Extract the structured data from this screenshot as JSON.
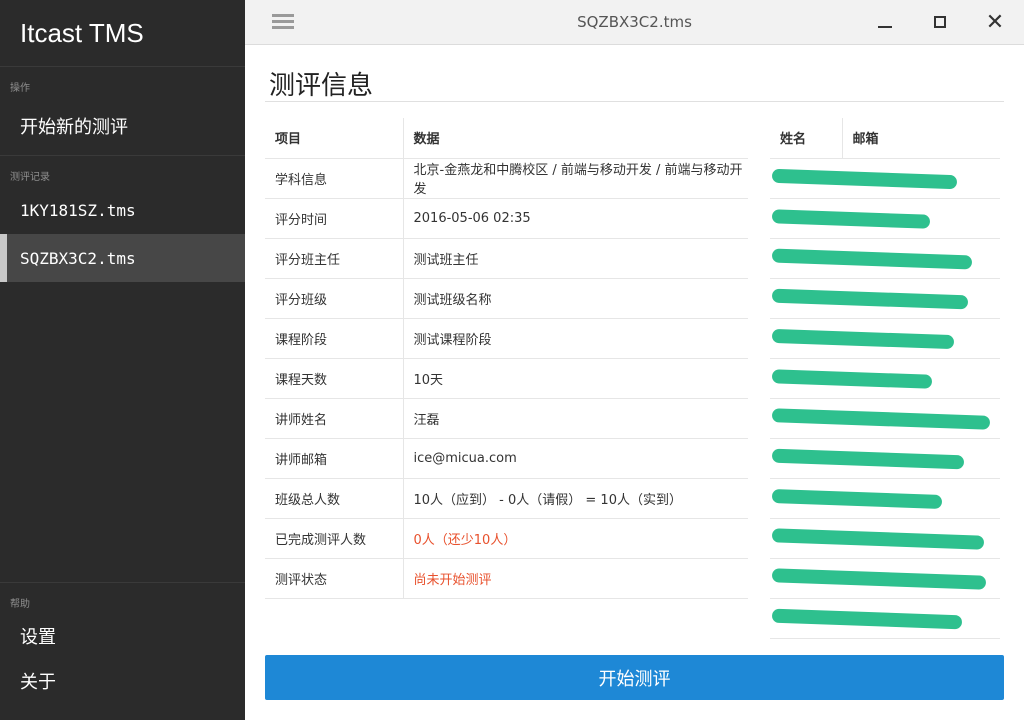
{
  "app": {
    "title": "Itcast TMS"
  },
  "sidebar": {
    "section_ops": "操作",
    "new_eval": "开始新的测评",
    "section_records": "测评记录",
    "records": [
      "1KY181SZ.tms",
      "SQZBX3C2.tms"
    ],
    "section_help": "帮助",
    "settings": "设置",
    "about": "关于"
  },
  "window": {
    "title": "SQZBX3C2.tms",
    "close_glyph": "✕"
  },
  "main": {
    "title": "测评信息",
    "info_headers": [
      "项目",
      "数据"
    ],
    "info_rows": [
      [
        "学科信息",
        "北京-金燕龙和中腾校区 / 前端与移动开发 / 前端与移动开发"
      ],
      [
        "评分时间",
        "2016-05-06 02:35"
      ],
      [
        "评分班主任",
        "测试班主任"
      ],
      [
        "评分班级",
        "测试班级名称"
      ],
      [
        "课程阶段",
        "测试课程阶段"
      ],
      [
        "课程天数",
        "10天"
      ],
      [
        "讲师姓名",
        "汪磊"
      ],
      [
        "讲师邮箱",
        "ice@micua.com"
      ],
      [
        "班级总人数",
        "10人（应到） - 0人（请假） = 10人（实到）"
      ],
      [
        "已完成测评人数",
        "0人（还少10人）"
      ],
      [
        "测评状态",
        "尚未开始测评"
      ]
    ],
    "users_headers": [
      "姓名",
      "邮箱"
    ],
    "start_button": "开始测评"
  },
  "colors": {
    "accent": "#1e88d6",
    "warning": "#e8512d",
    "redaction": "#2ec08e",
    "sidebar_bg": "#2b2b2b"
  }
}
